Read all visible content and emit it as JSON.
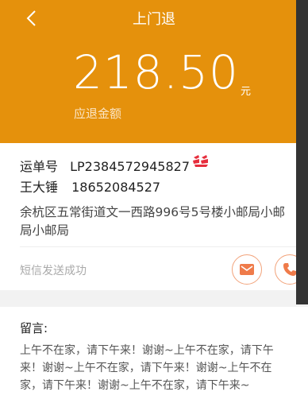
{
  "header": {
    "title": "上门退",
    "amount": "218.50",
    "unit": "元",
    "amount_label": "应退金额"
  },
  "order": {
    "waybill_label": "运单号",
    "waybill_no": "LP2384572945827",
    "logo_icon": "dangdang-logo",
    "name": "王大锤",
    "phone": "18652084527",
    "address": "余杭区五常街道文一西路996号5号楼小邮局小邮局小邮局",
    "sms_status": "短信发送成功"
  },
  "message": {
    "title": "留言:",
    "body": "上午不在家，请下午来！谢谢~上午不在家，请下午来！谢谢~上午不在家，请下午来！谢谢~上午不在家，请下午来！谢谢~上午不在家，请下午来~"
  },
  "colors": {
    "brand": "#e5910c",
    "accent": "#f2a37b",
    "logo_red": "#e62e3d"
  }
}
